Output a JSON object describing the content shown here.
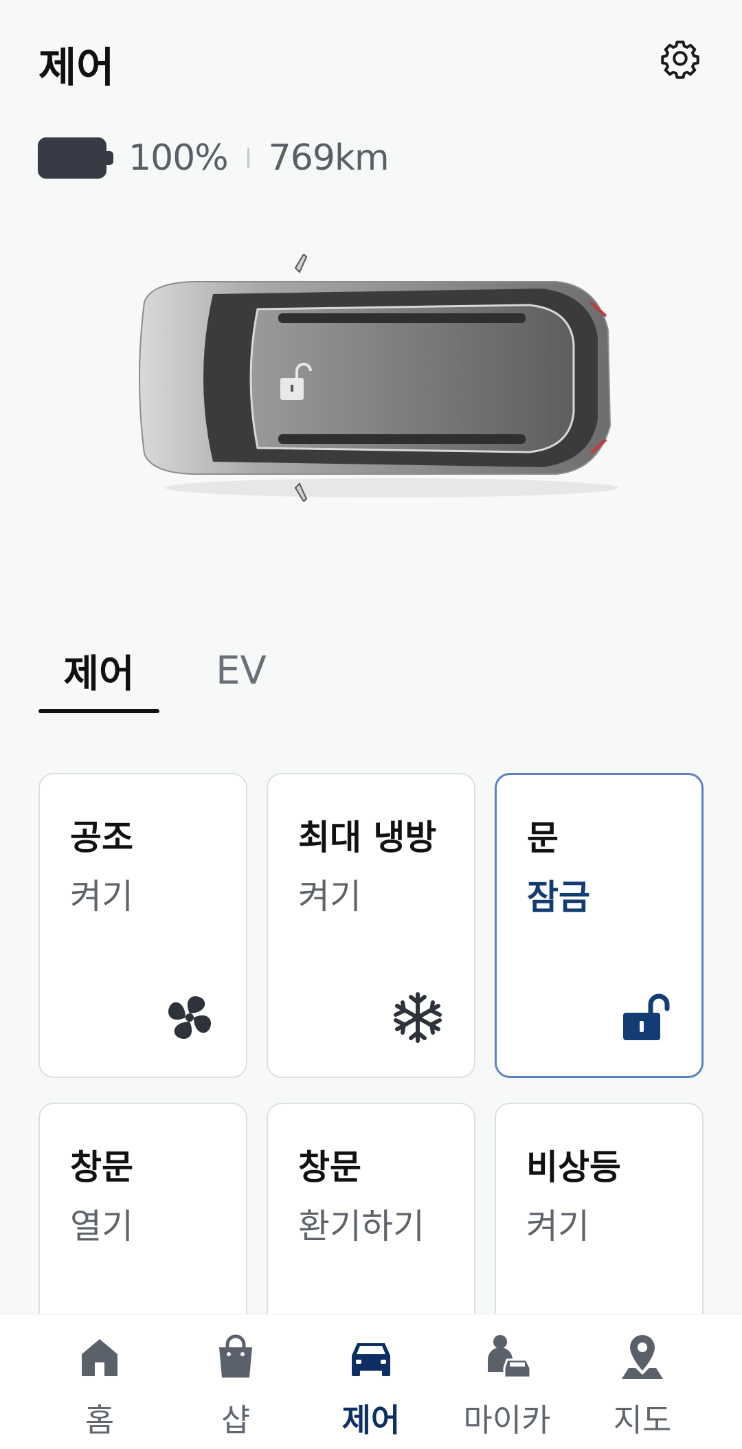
{
  "header": {
    "title": "제어"
  },
  "status": {
    "battery": "100%",
    "range": "769km"
  },
  "tabs": [
    {
      "label": "제어"
    },
    {
      "label": "EV"
    }
  ],
  "controls": [
    {
      "title": "공조",
      "status": "켜기",
      "icon": "fan-icon"
    },
    {
      "title": "최대 냉방",
      "status": "켜기",
      "icon": "snowflake-icon"
    },
    {
      "title": "문",
      "status": "잠금",
      "icon": "unlock-icon"
    },
    {
      "title": "창문",
      "status": "열기",
      "icon": "window-icon"
    },
    {
      "title": "창문",
      "status": "환기하기",
      "icon": "window-icon"
    },
    {
      "title": "비상등",
      "status": "켜기",
      "icon": "hazard-icon"
    }
  ],
  "nav": [
    {
      "label": "홈",
      "icon": "home-icon"
    },
    {
      "label": "샵",
      "icon": "shopping-bag-icon"
    },
    {
      "label": "제어",
      "icon": "car-icon"
    },
    {
      "label": "마이카",
      "icon": "person-car-icon"
    },
    {
      "label": "지도",
      "icon": "map-pin-icon"
    }
  ],
  "colors": {
    "accent": "#123c73",
    "active_border": "#5b82bd",
    "background": "#f7f8f8"
  }
}
